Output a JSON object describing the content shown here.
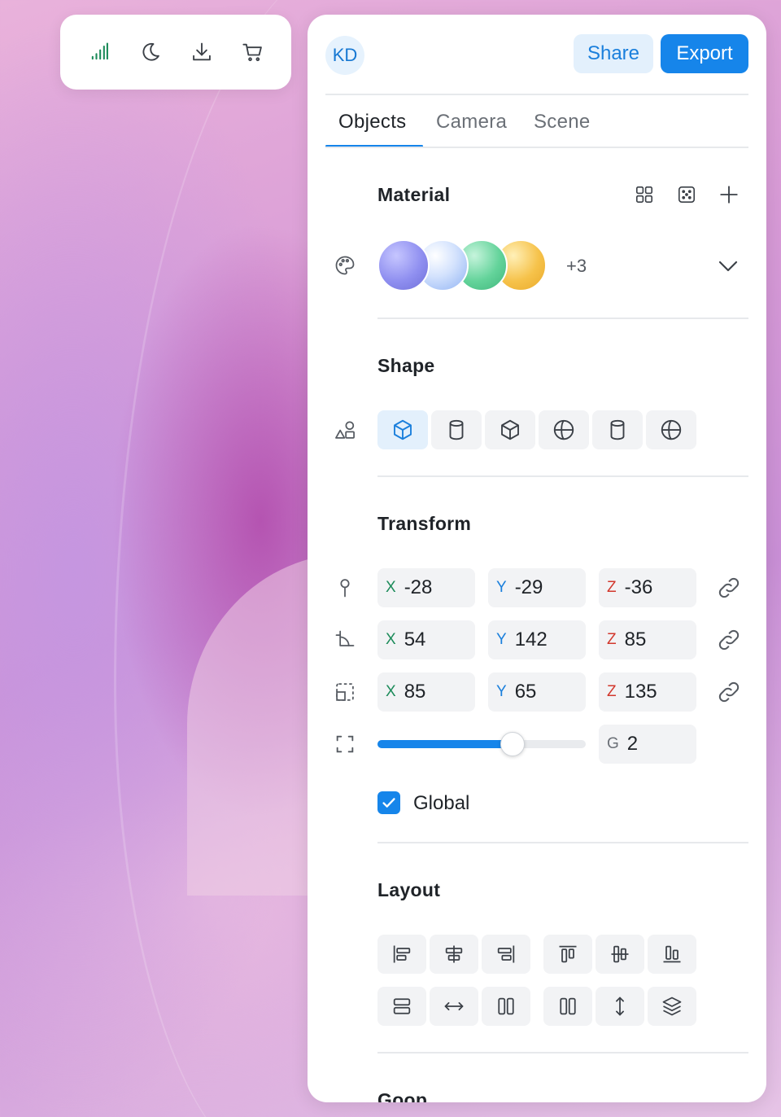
{
  "toolbar": {
    "icons": [
      "signal-icon",
      "moon-icon",
      "download-icon",
      "cart-icon"
    ]
  },
  "header": {
    "avatar_initials": "KD",
    "share_label": "Share",
    "export_label": "Export"
  },
  "tabs": [
    {
      "label": "Objects",
      "active": true
    },
    {
      "label": "Camera",
      "active": false
    },
    {
      "label": "Scene",
      "active": false
    }
  ],
  "material": {
    "title": "Material",
    "more_count": "+3",
    "swatch_colors": [
      "#8f8ff0",
      "#b9d0fb",
      "#63d39a",
      "#f6c24a"
    ]
  },
  "shape": {
    "title": "Shape",
    "options": [
      "cube-icon",
      "cylinder-icon",
      "box-icon",
      "sphere-icon",
      "cylinder-icon",
      "sphere-icon"
    ],
    "selected_index": 0
  },
  "transform": {
    "title": "Transform",
    "position": {
      "x": "-28",
      "y": "-29",
      "z": "-36"
    },
    "rotation": {
      "x": "54",
      "y": "142",
      "z": "85"
    },
    "scale": {
      "x": "85",
      "y": "65",
      "z": "135"
    },
    "axis_labels": {
      "x": "X",
      "y": "Y",
      "z": "Z",
      "g": "G"
    },
    "grid_value": "2",
    "grid_slider_fraction": 0.65,
    "global_label": "Global",
    "global_checked": true
  },
  "layout": {
    "title": "Layout"
  },
  "next_section": {
    "title": "Goop"
  },
  "colors": {
    "accent": "#1685ea",
    "axis_x": "#1c8b5a",
    "axis_y": "#1a7fdc",
    "axis_z": "#d2382d"
  }
}
